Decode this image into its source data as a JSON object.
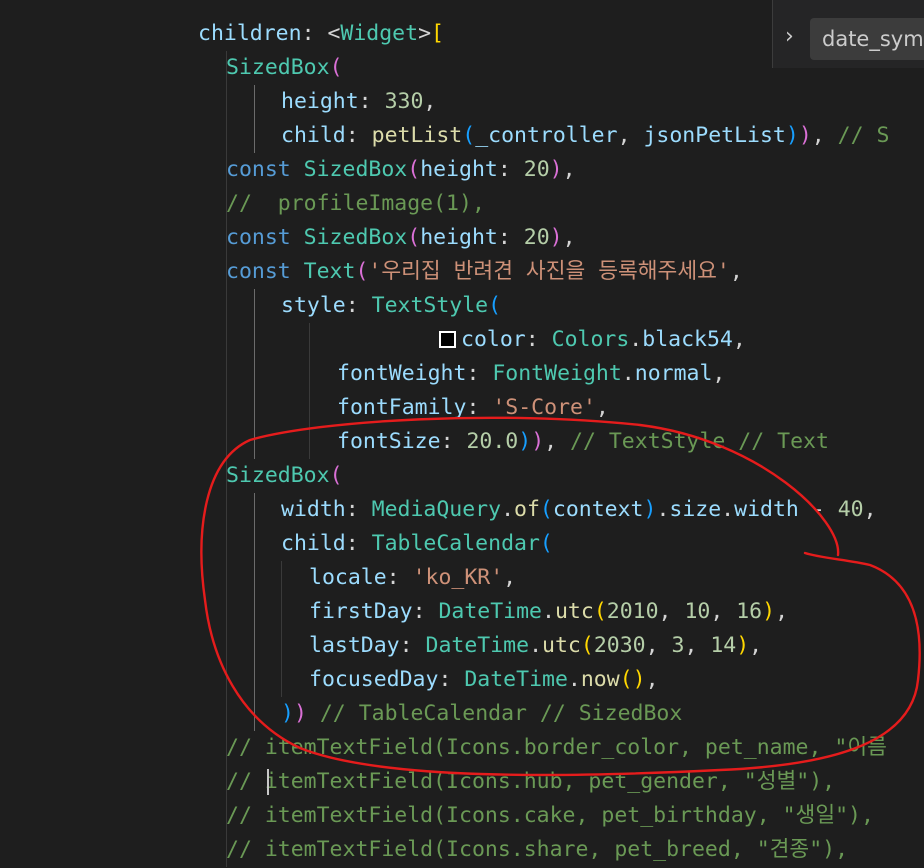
{
  "colors": {
    "default": "#d4d4d4",
    "keyword": "#569cd6",
    "class": "#4ec9b0",
    "function": "#dcdcaa",
    "property": "#9cdcfe",
    "number": "#b5cea8",
    "string": "#ce9178",
    "comment": "#6a9955",
    "bracket_gold": "#ffd700",
    "bracket_pink": "#da70d6",
    "bracket_blue": "#179fff",
    "annotation": "#e51c1c"
  },
  "breadcrumb": {
    "chevron_icon": "chevron-right-icon",
    "label": "date_symb"
  },
  "code_lines": [
    {
      "tokens": [
        {
          "t": "children",
          "c": "property"
        },
        {
          "t": ": ",
          "c": "default"
        },
        {
          "t": "<",
          "c": "default"
        },
        {
          "t": "Widget",
          "c": "class"
        },
        {
          "t": ">",
          "c": "default"
        },
        {
          "t": "[",
          "c": "bracket_gold"
        }
      ]
    },
    {
      "tokens": [
        {
          "t": "SizedBox",
          "c": "class"
        },
        {
          "t": "(",
          "c": "bracket_pink"
        }
      ]
    },
    {
      "tokens": [
        {
          "t": "height",
          "c": "property"
        },
        {
          "t": ": ",
          "c": "default"
        },
        {
          "t": "330",
          "c": "number"
        },
        {
          "t": ",",
          "c": "default"
        }
      ]
    },
    {
      "tokens": [
        {
          "t": "child",
          "c": "property"
        },
        {
          "t": ": ",
          "c": "default"
        },
        {
          "t": "petList",
          "c": "function"
        },
        {
          "t": "(",
          "c": "bracket_blue"
        },
        {
          "t": "_controller",
          "c": "property"
        },
        {
          "t": ", ",
          "c": "default"
        },
        {
          "t": "jsonPetList",
          "c": "property"
        },
        {
          "t": ")",
          "c": "bracket_blue"
        },
        {
          "t": ")",
          "c": "bracket_pink"
        },
        {
          "t": ", ",
          "c": "default"
        },
        {
          "t": "// S",
          "c": "comment"
        }
      ]
    },
    {
      "tokens": [
        {
          "t": "const ",
          "c": "keyword"
        },
        {
          "t": "SizedBox",
          "c": "class"
        },
        {
          "t": "(",
          "c": "bracket_pink"
        },
        {
          "t": "height",
          "c": "property"
        },
        {
          "t": ": ",
          "c": "default"
        },
        {
          "t": "20",
          "c": "number"
        },
        {
          "t": ")",
          "c": "bracket_pink"
        },
        {
          "t": ",",
          "c": "default"
        }
      ]
    },
    {
      "tokens": [
        {
          "t": "//  profileImage(1),",
          "c": "comment"
        }
      ]
    },
    {
      "tokens": [
        {
          "t": "const ",
          "c": "keyword"
        },
        {
          "t": "SizedBox",
          "c": "class"
        },
        {
          "t": "(",
          "c": "bracket_pink"
        },
        {
          "t": "height",
          "c": "property"
        },
        {
          "t": ": ",
          "c": "default"
        },
        {
          "t": "20",
          "c": "number"
        },
        {
          "t": ")",
          "c": "bracket_pink"
        },
        {
          "t": ",",
          "c": "default"
        }
      ]
    },
    {
      "tokens": [
        {
          "t": "const ",
          "c": "keyword"
        },
        {
          "t": "Text",
          "c": "class"
        },
        {
          "t": "(",
          "c": "bracket_pink"
        },
        {
          "t": "'우리집 반려견 사진을 등록해주세요'",
          "c": "string"
        },
        {
          "t": ",",
          "c": "default"
        }
      ]
    },
    {
      "tokens": [
        {
          "t": "style",
          "c": "property"
        },
        {
          "t": ": ",
          "c": "default"
        },
        {
          "t": "TextStyle",
          "c": "class"
        },
        {
          "t": "(",
          "c": "bracket_blue"
        }
      ]
    },
    {
      "swatch": true,
      "tokens": [
        {
          "t": "color",
          "c": "property"
        },
        {
          "t": ": ",
          "c": "default"
        },
        {
          "t": "Colors",
          "c": "class"
        },
        {
          "t": ".",
          "c": "default"
        },
        {
          "t": "black54",
          "c": "property"
        },
        {
          "t": ",",
          "c": "default"
        }
      ]
    },
    {
      "tokens": [
        {
          "t": "fontWeight",
          "c": "property"
        },
        {
          "t": ": ",
          "c": "default"
        },
        {
          "t": "FontWeight",
          "c": "class"
        },
        {
          "t": ".",
          "c": "default"
        },
        {
          "t": "normal",
          "c": "property"
        },
        {
          "t": ",",
          "c": "default"
        }
      ]
    },
    {
      "tokens": [
        {
          "t": "fontFamily",
          "c": "property"
        },
        {
          "t": ": ",
          "c": "default"
        },
        {
          "t": "'S-Core'",
          "c": "string"
        },
        {
          "t": ",",
          "c": "default"
        }
      ]
    },
    {
      "tokens": [
        {
          "t": "fontSize",
          "c": "property"
        },
        {
          "t": ": ",
          "c": "default"
        },
        {
          "t": "20.0",
          "c": "number"
        },
        {
          "t": ")",
          "c": "bracket_blue"
        },
        {
          "t": ")",
          "c": "bracket_pink"
        },
        {
          "t": ", ",
          "c": "default"
        },
        {
          "t": "// TextStyle // Text",
          "c": "comment"
        }
      ]
    },
    {
      "tokens": [
        {
          "t": "SizedBox",
          "c": "class"
        },
        {
          "t": "(",
          "c": "bracket_pink"
        }
      ]
    },
    {
      "tokens": [
        {
          "t": "width",
          "c": "property"
        },
        {
          "t": ": ",
          "c": "default"
        },
        {
          "t": "MediaQuery",
          "c": "class"
        },
        {
          "t": ".",
          "c": "default"
        },
        {
          "t": "of",
          "c": "function"
        },
        {
          "t": "(",
          "c": "bracket_blue"
        },
        {
          "t": "context",
          "c": "property"
        },
        {
          "t": ")",
          "c": "bracket_blue"
        },
        {
          "t": ".",
          "c": "default"
        },
        {
          "t": "size",
          "c": "property"
        },
        {
          "t": ".",
          "c": "default"
        },
        {
          "t": "width",
          "c": "property"
        },
        {
          "t": " - ",
          "c": "default"
        },
        {
          "t": "40",
          "c": "number"
        },
        {
          "t": ",",
          "c": "default"
        }
      ]
    },
    {
      "tokens": [
        {
          "t": "child",
          "c": "property"
        },
        {
          "t": ": ",
          "c": "default"
        },
        {
          "t": "TableCalendar",
          "c": "class"
        },
        {
          "t": "(",
          "c": "bracket_blue"
        }
      ]
    },
    {
      "tokens": [
        {
          "t": "locale",
          "c": "property"
        },
        {
          "t": ": ",
          "c": "default"
        },
        {
          "t": "'ko_KR'",
          "c": "string"
        },
        {
          "t": ",",
          "c": "default"
        }
      ]
    },
    {
      "tokens": [
        {
          "t": "firstDay",
          "c": "property"
        },
        {
          "t": ": ",
          "c": "default"
        },
        {
          "t": "DateTime",
          "c": "class"
        },
        {
          "t": ".",
          "c": "default"
        },
        {
          "t": "utc",
          "c": "function"
        },
        {
          "t": "(",
          "c": "bracket_gold"
        },
        {
          "t": "2010",
          "c": "number"
        },
        {
          "t": ", ",
          "c": "default"
        },
        {
          "t": "10",
          "c": "number"
        },
        {
          "t": ", ",
          "c": "default"
        },
        {
          "t": "16",
          "c": "number"
        },
        {
          "t": ")",
          "c": "bracket_gold"
        },
        {
          "t": ",",
          "c": "default"
        }
      ]
    },
    {
      "tokens": [
        {
          "t": "lastDay",
          "c": "property"
        },
        {
          "t": ": ",
          "c": "default"
        },
        {
          "t": "DateTime",
          "c": "class"
        },
        {
          "t": ".",
          "c": "default"
        },
        {
          "t": "utc",
          "c": "function"
        },
        {
          "t": "(",
          "c": "bracket_gold"
        },
        {
          "t": "2030",
          "c": "number"
        },
        {
          "t": ", ",
          "c": "default"
        },
        {
          "t": "3",
          "c": "number"
        },
        {
          "t": ", ",
          "c": "default"
        },
        {
          "t": "14",
          "c": "number"
        },
        {
          "t": ")",
          "c": "bracket_gold"
        },
        {
          "t": ",",
          "c": "default"
        }
      ]
    },
    {
      "tokens": [
        {
          "t": "focusedDay",
          "c": "property"
        },
        {
          "t": ": ",
          "c": "default"
        },
        {
          "t": "DateTime",
          "c": "class"
        },
        {
          "t": ".",
          "c": "default"
        },
        {
          "t": "now",
          "c": "function"
        },
        {
          "t": "(",
          "c": "bracket_gold"
        },
        {
          "t": ")",
          "c": "bracket_gold"
        },
        {
          "t": ",",
          "c": "default"
        }
      ]
    },
    {
      "tokens": [
        {
          "t": ")",
          "c": "bracket_blue"
        },
        {
          "t": ")",
          "c": "bracket_pink"
        },
        {
          "t": " ",
          "c": "default"
        },
        {
          "t": "// TableCalendar // SizedBox",
          "c": "comment"
        }
      ]
    },
    {
      "tokens": [
        {
          "t": "// itemTextField(Icons.border_color, pet_name, \"이름",
          "c": "comment"
        }
      ]
    },
    {
      "tokens": [
        {
          "t": "// itemTextField(Icons.hub, pet_gender, \"성별\"),",
          "c": "comment"
        }
      ]
    },
    {
      "tokens": [
        {
          "t": "// itemTextField(Icons.cake, pet_birthday, \"생일\"),",
          "c": "comment"
        }
      ]
    },
    {
      "tokens": [
        {
          "t": "// itemTextField(Icons.share, pet_breed, \"견종\"),",
          "c": "comment"
        }
      ]
    }
  ]
}
